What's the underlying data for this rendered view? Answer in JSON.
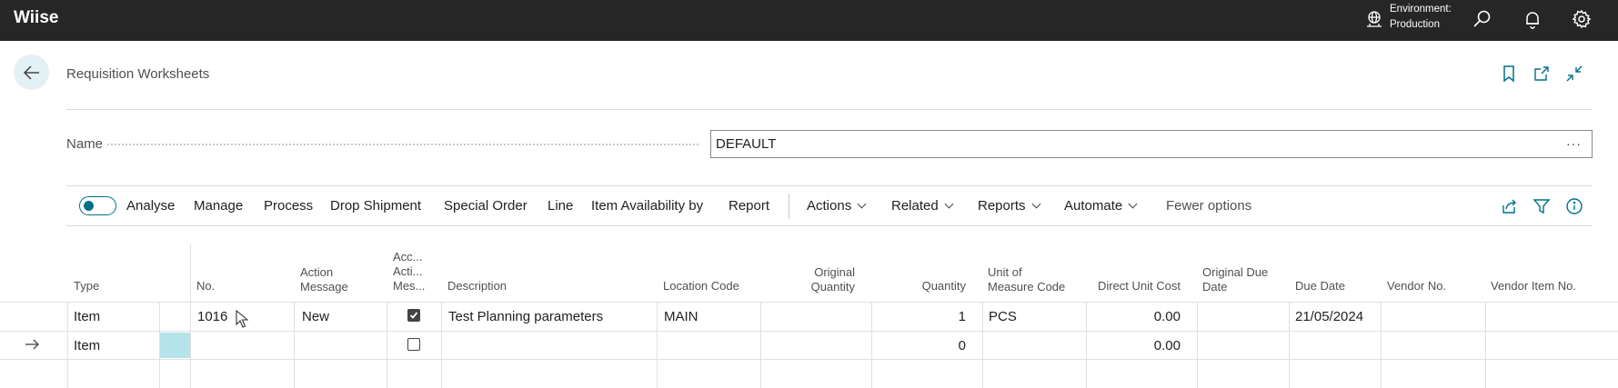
{
  "topbar": {
    "brand": "Wiise",
    "env_line1": "Environment:",
    "env_line2": "Production"
  },
  "page": {
    "title": "Requisition Worksheets"
  },
  "name_field": {
    "label": "Name",
    "value": "DEFAULT",
    "more": "···"
  },
  "actions": {
    "analyse": "Analyse",
    "manage": "Manage",
    "process": "Process",
    "drop_shipment": "Drop Shipment",
    "special_order": "Special Order",
    "line": "Line",
    "item_availability": "Item Availability by",
    "report": "Report",
    "actions_menu": "Actions",
    "related": "Related",
    "reports": "Reports",
    "automate": "Automate",
    "fewer_options": "Fewer options"
  },
  "columns": {
    "type": "Type",
    "no": "No.",
    "action_message_1": "Action",
    "action_message_2": "Message",
    "acc_1": "Acc...",
    "acc_2": "Acti...",
    "acc_3": "Mes...",
    "description": "Description",
    "location_code": "Location Code",
    "original_quantity_1": "Original",
    "original_quantity_2": "Quantity",
    "quantity": "Quantity",
    "uom_1": "Unit of",
    "uom_2": "Measure Code",
    "direct_unit_cost": "Direct Unit Cost",
    "original_due_1": "Original Due",
    "original_due_2": "Date",
    "due_date": "Due Date",
    "vendor_no": "Vendor No.",
    "vendor_item_no": "Vendor Item No."
  },
  "rows": [
    {
      "type": "Item",
      "no": "1016",
      "action_message": "New",
      "accept": true,
      "description": "Test Planning parameters",
      "location_code": "MAIN",
      "original_quantity": "",
      "quantity": "1",
      "uom": "PCS",
      "direct_unit_cost": "0.00",
      "original_due_date": "",
      "due_date": "21/05/2024",
      "vendor_no": "",
      "vendor_item_no": ""
    },
    {
      "type": "Item",
      "no": "",
      "action_message": "",
      "accept": false,
      "description": "",
      "location_code": "",
      "original_quantity": "",
      "quantity": "0",
      "uom": "",
      "direct_unit_cost": "0.00",
      "original_due_date": "",
      "due_date": "",
      "vendor_no": "",
      "vendor_item_no": ""
    }
  ],
  "colors": {
    "topbar": "#262626",
    "accent": "#00708a",
    "selected_cell": "#b4e3ea"
  }
}
